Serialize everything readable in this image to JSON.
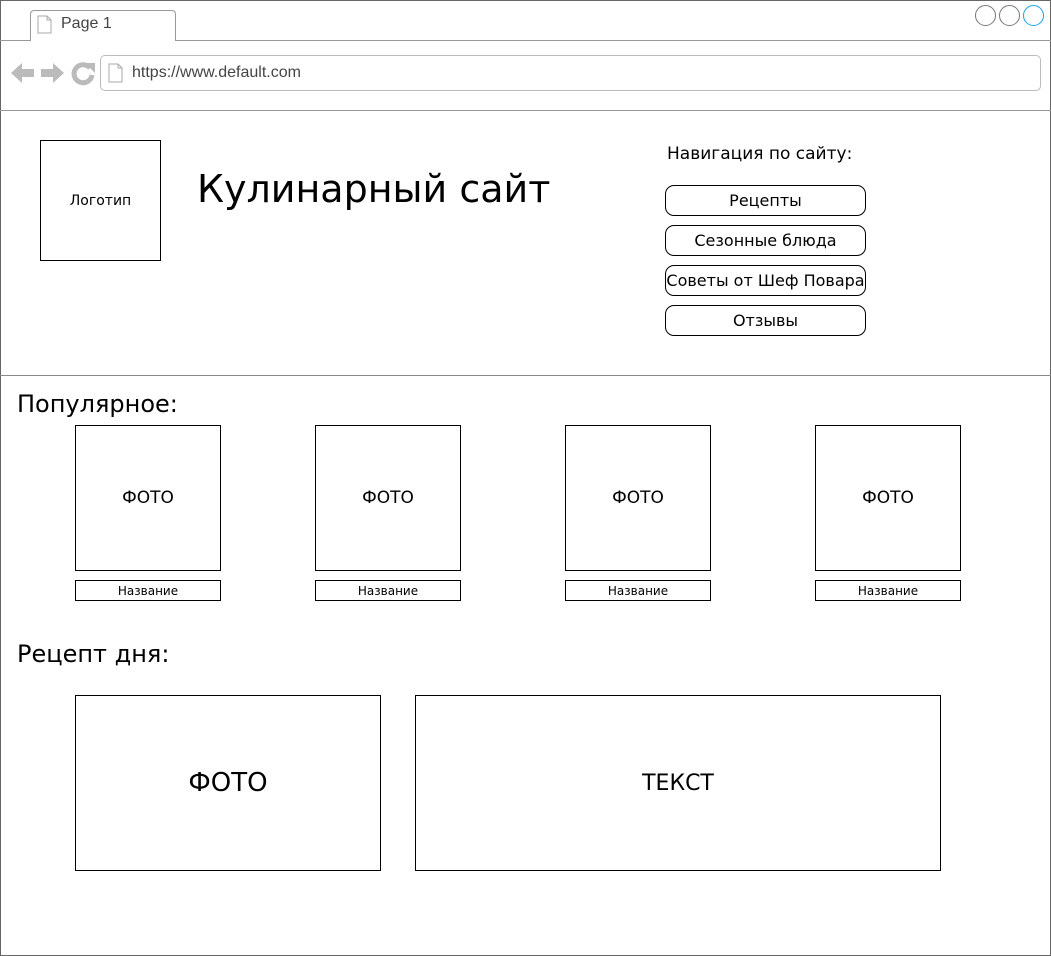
{
  "browser": {
    "tab_title": "Page 1",
    "url": "https://www.default.com"
  },
  "header": {
    "logo_label": "Логотип",
    "site_title": "Кулинарный сайт",
    "nav_heading": "Навигация по сайту:",
    "nav_items": [
      "Рецепты",
      "Сезонные блюда",
      "Советы от Шеф Повара",
      "Отзывы"
    ]
  },
  "popular": {
    "title": "Популярное:",
    "items": [
      {
        "photo": "ФОТО",
        "name": "Название"
      },
      {
        "photo": "ФОТО",
        "name": "Название"
      },
      {
        "photo": "ФОТО",
        "name": "Название"
      },
      {
        "photo": "ФОТО",
        "name": "Название"
      }
    ]
  },
  "recipe_of_day": {
    "title": "Рецепт дня:",
    "photo": "ФОТО",
    "text": "ТЕКСТ"
  },
  "colors": {
    "window_button_accent": "#1ba1e2",
    "chrome_icon": "#bbbbbb"
  }
}
